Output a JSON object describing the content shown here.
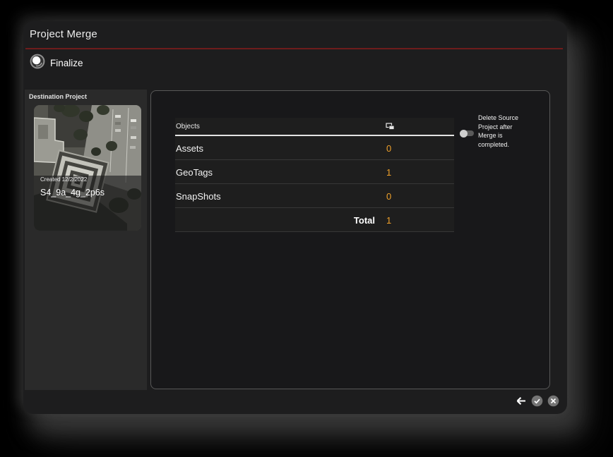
{
  "window": {
    "title": "Project Merge"
  },
  "finalize": {
    "label": "Finalize",
    "icon": "finalize-step-icon"
  },
  "sidebar": {
    "section_label": "Destination Project",
    "project": {
      "created": "Created 12/2/2022",
      "name": "S4_9a_4g_2p6s",
      "thumbnail": "aerial-satellite-view"
    }
  },
  "table": {
    "header": "Objects",
    "header_icon": "stacked-objects-icon",
    "rows": [
      {
        "label": "Assets",
        "value": "0"
      },
      {
        "label": "GeoTags",
        "value": "1"
      },
      {
        "label": "SnapShots",
        "value": "0"
      }
    ],
    "total_label": "Total",
    "total_value": "1"
  },
  "delete_toggle": {
    "label": "Delete Source Project after Merge is completed.",
    "state": "off"
  },
  "footer": {
    "icons": [
      "back-arrow-icon",
      "confirm-check-icon",
      "cancel-x-icon"
    ]
  },
  "colors": {
    "value_orange": "#efa02a",
    "divider_red": "#6e1c1c",
    "dialog_bg": "#1d1d1e",
    "sidebar_bg": "#2a2a2a"
  }
}
